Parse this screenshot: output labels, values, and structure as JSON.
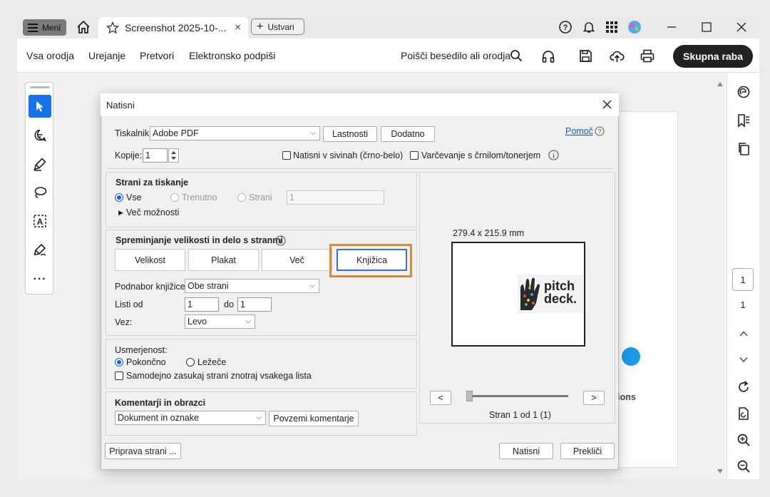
{
  "tabbar": {
    "menu_label": "Meni",
    "tab_title": "Screenshot 2025-10-...",
    "tab_close": "×",
    "create_label": "Ustvari"
  },
  "toolbar": {
    "links": [
      "Vsa orodja",
      "Urejanje",
      "Pretvori",
      "Elektronsko podpiši"
    ],
    "search_label": "Poišči besedilo ali orodja",
    "share_label": "Skupna raba"
  },
  "right_panel": {
    "page_current": "1",
    "page_total": "1"
  },
  "dialog": {
    "title": "Natisni",
    "printer_label": "Tiskalnik:",
    "printer_value": "Adobe PDF",
    "properties_btn": "Lastnosti",
    "advanced_btn": "Dodatno",
    "help_link": "Pomoč",
    "copies_label": "Kopije:",
    "copies_value": "1",
    "grayscale_label": "Natisni v sivinah (črno-belo)",
    "ink_saving_label": "Varčevanje s črnilom/tonerjem",
    "pages_section": {
      "title": "Strani za tiskanje",
      "all": "Vse",
      "current": "Trenutno",
      "pages": "Strani",
      "pages_value": "1",
      "more_options": "Več možnosti"
    },
    "sizing_section": {
      "title": "Spreminjanje velikosti in delo s stranmi",
      "tabs": [
        "Velikost",
        "Plakat",
        "Več",
        "Knjižica"
      ],
      "subset_label": "Podnabor knjižice:",
      "subset_value": "Obe strani",
      "sheets_label": "Listi od",
      "sheets_from": "1",
      "to_label": "do",
      "sheets_to": "1",
      "binding_label": "Vez:",
      "binding_value": "Levo"
    },
    "orientation_section": {
      "title": "Usmerjenost:",
      "portrait": "Pokončno",
      "landscape": "Ležeče",
      "auto_rotate": "Samodejno zasukaj strani znotraj vsakega lista"
    },
    "comments_section": {
      "title": "Komentarji in obrazci",
      "value": "Dokument in oznake",
      "summarize_btn": "Povzemi komentarje"
    },
    "preview": {
      "size_label": "279.4 x 215.9 mm",
      "prev": "<",
      "next": ">",
      "page_status": "Stran 1 od 1 (1)",
      "thumb_text_1": "pitch",
      "thumb_text_2": "deck."
    },
    "page_setup_btn": "Priprava strani ...",
    "print_btn": "Natisni",
    "cancel_btn": "Prekliči"
  },
  "background_fragment": "tions",
  "colors": {
    "accent": "#1473e6",
    "highlight": "#d18b3a",
    "radio": "#1a5bd3"
  }
}
